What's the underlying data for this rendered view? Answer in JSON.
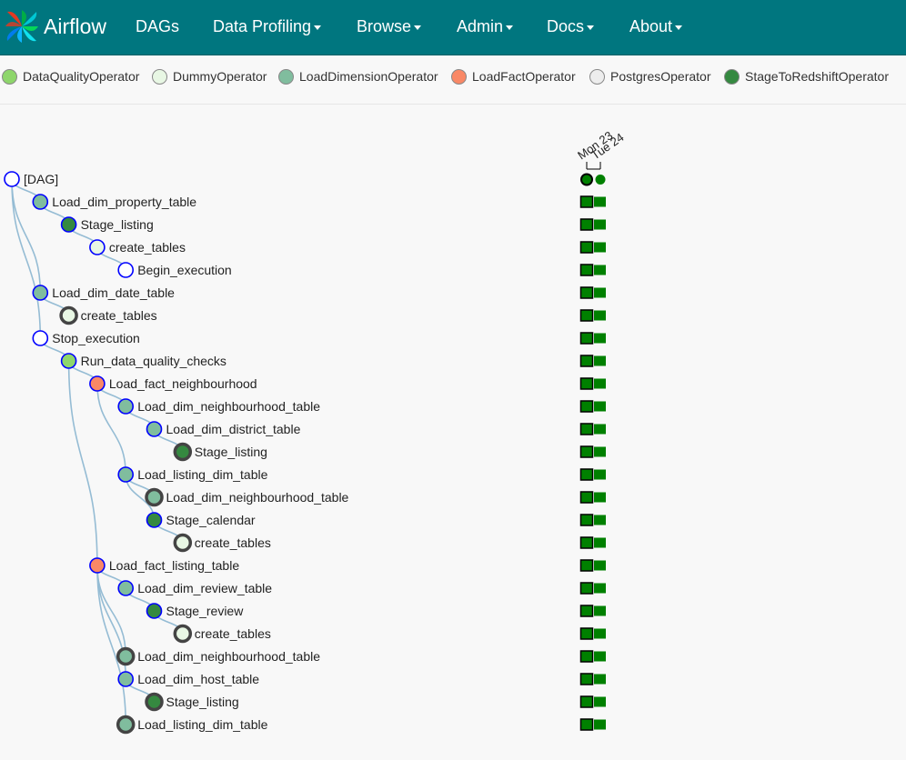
{
  "app": {
    "brand": "Airflow"
  },
  "nav": [
    {
      "label": "DAGs",
      "dropdown": false
    },
    {
      "label": "Data Profiling",
      "dropdown": true
    },
    {
      "label": "Browse",
      "dropdown": true
    },
    {
      "label": "Admin",
      "dropdown": true
    },
    {
      "label": "Docs",
      "dropdown": true
    },
    {
      "label": "About",
      "dropdown": true
    }
  ],
  "legend": [
    {
      "label": "DataQualityOperator",
      "color": "#8ed66b"
    },
    {
      "label": "DummyOperator",
      "color": "#e8f7e4"
    },
    {
      "label": "LoadDimensionOperator",
      "color": "#80bd9e"
    },
    {
      "label": "LoadFactOperator",
      "color": "#f98866"
    },
    {
      "label": "PostgresOperator",
      "color": "#ededed"
    },
    {
      "label": "StageToRedshiftOperator",
      "color": "#358940"
    }
  ],
  "dag_runs": [
    "Mon 23",
    "Tue 24"
  ],
  "tree": [
    {
      "label": "[DAG]",
      "depth": 0,
      "operator": "DAG",
      "dup": false
    },
    {
      "label": "Load_dim_property_table",
      "depth": 1,
      "operator": "LoadDimensionOperator",
      "dup": false
    },
    {
      "label": "Stage_listing",
      "depth": 2,
      "operator": "StageToRedshiftOperator",
      "dup": false
    },
    {
      "label": "create_tables",
      "depth": 3,
      "operator": "DummyOperator",
      "dup": false
    },
    {
      "label": "Begin_execution",
      "depth": 4,
      "operator": "DAG",
      "dup": false
    },
    {
      "label": "Load_dim_date_table",
      "depth": 1,
      "operator": "LoadDimensionOperator",
      "dup": false
    },
    {
      "label": "create_tables",
      "depth": 2,
      "operator": "DummyOperator",
      "dup": true
    },
    {
      "label": "Stop_execution",
      "depth": 1,
      "operator": "DAG",
      "dup": false
    },
    {
      "label": "Run_data_quality_checks",
      "depth": 2,
      "operator": "DataQualityOperator",
      "dup": false
    },
    {
      "label": "Load_fact_neighbourhood",
      "depth": 3,
      "operator": "LoadFactOperator",
      "dup": false
    },
    {
      "label": "Load_dim_neighbourhood_table",
      "depth": 4,
      "operator": "LoadDimensionOperator",
      "dup": false
    },
    {
      "label": "Load_dim_district_table",
      "depth": 5,
      "operator": "LoadDimensionOperator",
      "dup": false
    },
    {
      "label": "Stage_listing",
      "depth": 6,
      "operator": "StageToRedshiftOperator",
      "dup": true
    },
    {
      "label": "Load_listing_dim_table",
      "depth": 4,
      "operator": "LoadDimensionOperator",
      "dup": false
    },
    {
      "label": "Load_dim_neighbourhood_table",
      "depth": 5,
      "operator": "LoadDimensionOperator",
      "dup": true
    },
    {
      "label": "Stage_calendar",
      "depth": 5,
      "operator": "StageToRedshiftOperator",
      "dup": false
    },
    {
      "label": "create_tables",
      "depth": 6,
      "operator": "DummyOperator",
      "dup": true
    },
    {
      "label": "Load_fact_listing_table",
      "depth": 3,
      "operator": "LoadFactOperator",
      "dup": false
    },
    {
      "label": "Load_dim_review_table",
      "depth": 4,
      "operator": "LoadDimensionOperator",
      "dup": false
    },
    {
      "label": "Stage_review",
      "depth": 5,
      "operator": "StageToRedshiftOperator",
      "dup": false
    },
    {
      "label": "create_tables",
      "depth": 6,
      "operator": "DummyOperator",
      "dup": true
    },
    {
      "label": "Load_dim_neighbourhood_table",
      "depth": 4,
      "operator": "LoadDimensionOperator",
      "dup": true
    },
    {
      "label": "Load_dim_host_table",
      "depth": 4,
      "operator": "LoadDimensionOperator",
      "dup": false
    },
    {
      "label": "Stage_listing",
      "depth": 5,
      "operator": "StageToRedshiftOperator",
      "dup": true
    },
    {
      "label": "Load_listing_dim_table",
      "depth": 4,
      "operator": "LoadDimensionOperator",
      "dup": true
    }
  ],
  "colors": {
    "navbar": "#00767f",
    "link": "#95bcd4",
    "node_border": "#0000ff",
    "dup_border": "#444444",
    "task_success": "#008000",
    "run_success": "#008000"
  },
  "icons": [
    "airflow-pinwheel-logo",
    "caret-down-icon"
  ]
}
